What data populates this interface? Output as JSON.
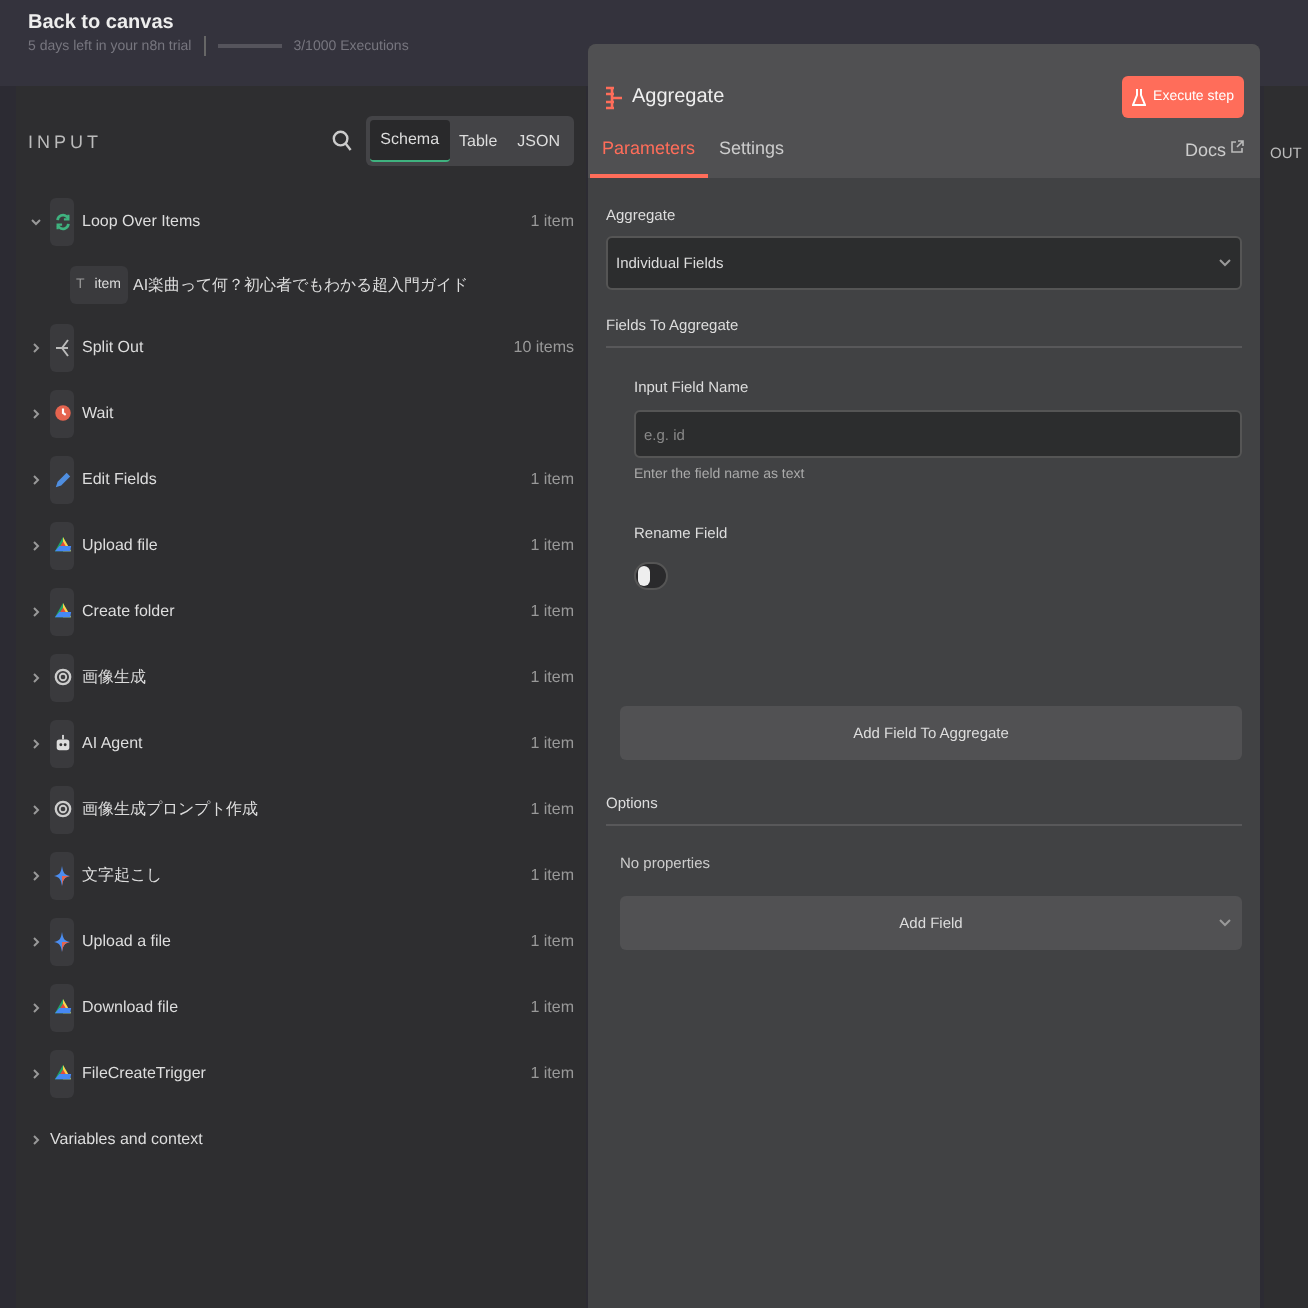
{
  "top_bar": {
    "back_link": "Back to canvas",
    "trial_text": "5 days left in your n8n trial",
    "executions": "3/1000 Executions"
  },
  "input_panel": {
    "title": "INPUT",
    "view_tabs": [
      {
        "label": "Schema",
        "selected": true
      },
      {
        "label": "Table",
        "selected": false
      },
      {
        "label": "JSON",
        "selected": false
      }
    ],
    "nodes": [
      {
        "name": "Loop Over Items",
        "count": "1 item",
        "kind": "loop",
        "expanded": true,
        "children": [
          {
            "type_icon": "T",
            "key": "item",
            "value": "AI楽曲って何？初心者でもわかる超入門ガイド"
          }
        ]
      },
      {
        "name": "Split Out",
        "count": "10 items",
        "kind": "split",
        "expanded": false
      },
      {
        "name": "Wait",
        "kind": "wait",
        "expanded": false
      },
      {
        "name": "Edit Fields",
        "count": "1 item",
        "kind": "edit",
        "expanded": false
      },
      {
        "name": "Upload file",
        "count": "1 item",
        "kind": "drive",
        "expanded": false
      },
      {
        "name": "Create folder",
        "count": "1 item",
        "kind": "drive",
        "expanded": false
      },
      {
        "name": "画像生成",
        "count": "1 item",
        "kind": "openai",
        "expanded": false
      },
      {
        "name": "AI Agent",
        "count": "1 item",
        "kind": "agent",
        "expanded": false
      },
      {
        "name": "画像生成プロンプト作成",
        "count": "1 item",
        "kind": "openai",
        "expanded": false
      },
      {
        "name": "文字起こし",
        "count": "1 item",
        "kind": "gem",
        "expanded": false
      },
      {
        "name": "Upload a file",
        "count": "1 item",
        "kind": "gem",
        "expanded": false
      },
      {
        "name": "Download file",
        "count": "1 item",
        "kind": "drive",
        "expanded": false
      },
      {
        "name": "FileCreateTrigger",
        "count": "1 item",
        "kind": "drive",
        "expanded": false
      }
    ],
    "footer_section": "Variables and context"
  },
  "node_panel": {
    "title": "Aggregate",
    "execute_button": "Execute step",
    "tabs": [
      {
        "label": "Parameters",
        "selected": true
      },
      {
        "label": "Settings",
        "selected": false
      }
    ],
    "docs_link": "Docs",
    "aggregate": {
      "label": "Aggregate",
      "value": "Individual Fields"
    },
    "fields_section": "Fields To Aggregate",
    "input_field": {
      "label": "Input Field Name",
      "placeholder": "e.g. id",
      "hint": "Enter the field name as text"
    },
    "rename_field": {
      "label": "Rename Field",
      "on": false
    },
    "add_field_to_aggregate": "Add Field To Aggregate",
    "options_section": "Options",
    "options_empty": "No properties",
    "add_field": "Add Field"
  },
  "output_panel": {
    "title": "OUT"
  }
}
